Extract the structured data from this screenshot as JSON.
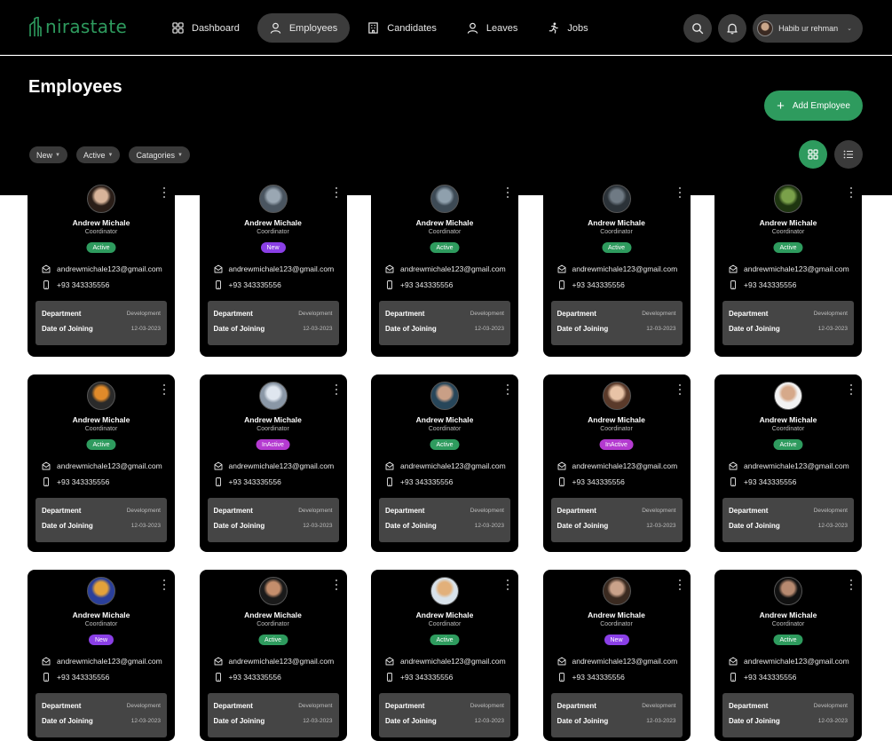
{
  "app": {
    "logo": "nirastate",
    "accent": "#2e9b5e"
  },
  "nav": [
    {
      "label": "Dashboard",
      "icon": "dashboard-icon",
      "active": false
    },
    {
      "label": "Employees",
      "icon": "user-icon",
      "active": true
    },
    {
      "label": "Candidates",
      "icon": "building-icon",
      "active": false
    },
    {
      "label": "Leaves",
      "icon": "user-icon",
      "active": false
    },
    {
      "label": "Jobs",
      "icon": "running-person-icon",
      "active": false
    }
  ],
  "header": {
    "user_name": "Habib ur rehman"
  },
  "page": {
    "title": "Employees",
    "add_button": "Add Employee"
  },
  "filters": [
    "New",
    "Active",
    "Catagories"
  ],
  "status_colors": {
    "Active": "#2e9b5e",
    "New": "#8a3fe6",
    "InActive": "#b43ad0"
  },
  "employees": [
    {
      "name": "Andrew Michale",
      "role": "Coordinator",
      "status": "Active",
      "email": "andrewmichale123@gmail.com",
      "phone": "+93 343335556",
      "department_label": "Department",
      "department": "Development",
      "joining_label": "Date of Joining",
      "joining": "12-03-2023",
      "avatar": [
        "#d8b49a",
        "#2a1e18"
      ]
    },
    {
      "name": "Andrew Michale",
      "role": "Coordinator",
      "status": "New",
      "email": "andrewmichale123@gmail.com",
      "phone": "+93 343335556",
      "department_label": "Department",
      "department": "Development",
      "joining_label": "Date of Joining",
      "joining": "12-03-2023",
      "avatar": [
        "#9aa7b3",
        "#4a5560"
      ]
    },
    {
      "name": "Andrew Michale",
      "role": "Coordinator",
      "status": "Active",
      "email": "andrewmichale123@gmail.com",
      "phone": "+93 343335556",
      "department_label": "Department",
      "department": "Development",
      "joining_label": "Date of Joining",
      "joining": "12-03-2023",
      "avatar": [
        "#8fa0ad",
        "#3d4a55"
      ]
    },
    {
      "name": "Andrew Michale",
      "role": "Coordinator",
      "status": "Active",
      "email": "andrewmichale123@gmail.com",
      "phone": "+93 343335556",
      "department_label": "Department",
      "department": "Development",
      "joining_label": "Date of Joining",
      "joining": "12-03-2023",
      "avatar": [
        "#6f7a84",
        "#2b3238"
      ]
    },
    {
      "name": "Andrew Michale",
      "role": "Coordinator",
      "status": "Active",
      "email": "andrewmichale123@gmail.com",
      "phone": "+93 343335556",
      "department_label": "Department",
      "department": "Development",
      "joining_label": "Date of Joining",
      "joining": "12-03-2023",
      "avatar": [
        "#7aa14a",
        "#1e3510"
      ]
    },
    {
      "name": "Andrew Michale",
      "role": "Coordinator",
      "status": "Active",
      "email": "andrewmichale123@gmail.com",
      "phone": "+93 343335556",
      "department_label": "Department",
      "department": "Development",
      "joining_label": "Date of Joining",
      "joining": "12-03-2023",
      "avatar": [
        "#e08a2a",
        "#2a2a2a"
      ]
    },
    {
      "name": "Andrew Michale",
      "role": "Coordinator",
      "status": "InActive",
      "email": "andrewmichale123@gmail.com",
      "phone": "+93 343335556",
      "department_label": "Department",
      "department": "Development",
      "joining_label": "Date of Joining",
      "joining": "12-03-2023",
      "avatar": [
        "#dfe6ef",
        "#8a97a6"
      ]
    },
    {
      "name": "Andrew Michale",
      "role": "Coordinator",
      "status": "Active",
      "email": "andrewmichale123@gmail.com",
      "phone": "+93 343335556",
      "department_label": "Department",
      "department": "Development",
      "joining_label": "Date of Joining",
      "joining": "12-03-2023",
      "avatar": [
        "#c99f86",
        "#27465a"
      ]
    },
    {
      "name": "Andrew Michale",
      "role": "Coordinator",
      "status": "InActive",
      "email": "andrewmichale123@gmail.com",
      "phone": "+93 343335556",
      "department_label": "Department",
      "department": "Development",
      "joining_label": "Date of Joining",
      "joining": "12-03-2023",
      "avatar": [
        "#e8c3a6",
        "#5a3a2a"
      ]
    },
    {
      "name": "Andrew Michale",
      "role": "Coordinator",
      "status": "Active",
      "email": "andrewmichale123@gmail.com",
      "phone": "+93 343335556",
      "department_label": "Department",
      "department": "Development",
      "joining_label": "Date of Joining",
      "joining": "12-03-2023",
      "avatar": [
        "#d6a98a",
        "#f2f2f2"
      ]
    },
    {
      "name": "Andrew Michale",
      "role": "Coordinator",
      "status": "New",
      "email": "andrewmichale123@gmail.com",
      "phone": "+93 343335556",
      "department_label": "Department",
      "department": "Development",
      "joining_label": "Date of Joining",
      "joining": "12-03-2023",
      "avatar": [
        "#e3a23a",
        "#2a3f9a"
      ]
    },
    {
      "name": "Andrew Michale",
      "role": "Coordinator",
      "status": "Active",
      "email": "andrewmichale123@gmail.com",
      "phone": "+93 343335556",
      "department_label": "Department",
      "department": "Development",
      "joining_label": "Date of Joining",
      "joining": "12-03-2023",
      "avatar": [
        "#c48e6c",
        "#1a1a1a"
      ]
    },
    {
      "name": "Andrew Michale",
      "role": "Coordinator",
      "status": "Active",
      "email": "andrewmichale123@gmail.com",
      "phone": "+93 343335556",
      "department_label": "Department",
      "department": "Development",
      "joining_label": "Date of Joining",
      "joining": "12-03-2023",
      "avatar": [
        "#e2b07a",
        "#d8e2ea"
      ]
    },
    {
      "name": "Andrew Michale",
      "role": "Coordinator",
      "status": "New",
      "email": "andrewmichale123@gmail.com",
      "phone": "+93 343335556",
      "department_label": "Department",
      "department": "Development",
      "joining_label": "Date of Joining",
      "joining": "12-03-2023",
      "avatar": [
        "#caa28a",
        "#3a2a20"
      ]
    },
    {
      "name": "Andrew Michale",
      "role": "Coordinator",
      "status": "Active",
      "email": "andrewmichale123@gmail.com",
      "phone": "+93 343335556",
      "department_label": "Department",
      "department": "Development",
      "joining_label": "Date of Joining",
      "joining": "12-03-2023",
      "avatar": [
        "#b78a70",
        "#111111"
      ]
    }
  ]
}
